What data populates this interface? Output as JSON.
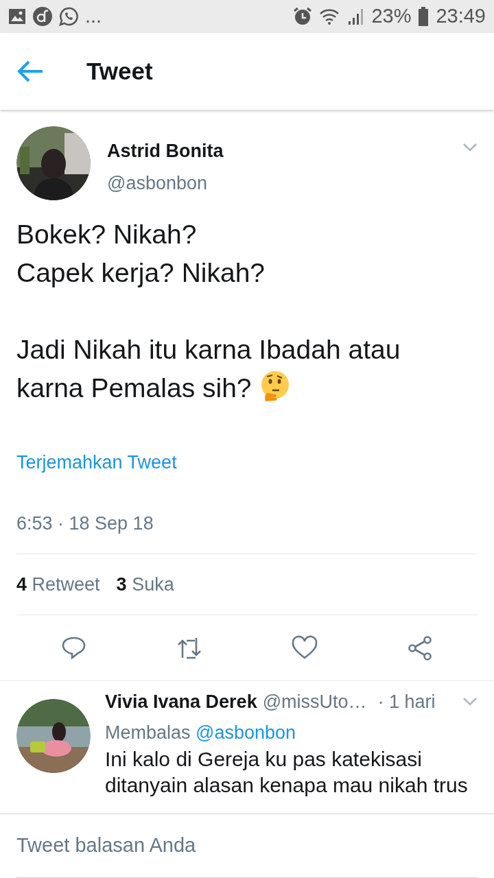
{
  "status_bar": {
    "more": "...",
    "battery": "23%",
    "time": "23:49"
  },
  "header": {
    "title": "Tweet"
  },
  "tweet": {
    "author_name": "Astrid Bonita",
    "handle": "@asbonbon",
    "paragraphs": [
      "Bokek? Nikah?\nCapek kerja? Nikah?",
      "Jadi Nikah itu karna Ibadah atau karna Pemalas sih?"
    ],
    "translate_link": "Terjemahkan Tweet",
    "timestamp": "6:53 · 18 Sep 18",
    "stats": [
      {
        "count": "4",
        "label": "Retweet"
      },
      {
        "count": "3",
        "label": "Suka"
      }
    ]
  },
  "reply": {
    "author_name": "Vivia Ivana Derek",
    "handle": "@missUto…",
    "time": "· 1 hari",
    "replying_label": "Membalas",
    "replying_to": "@asbonbon",
    "text": "Ini kalo di Gereja ku pas katekisasi ditanyain alasan kenapa mau nikah trus"
  },
  "compose": {
    "placeholder": "Tweet balasan Anda"
  }
}
